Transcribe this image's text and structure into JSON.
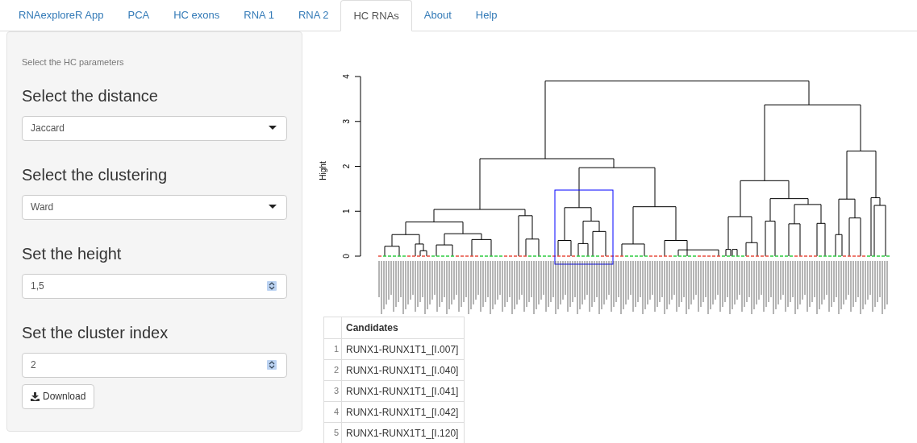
{
  "tabs": [
    {
      "label": "RNAexploreR App",
      "selected": false
    },
    {
      "label": "PCA",
      "selected": false
    },
    {
      "label": "HC exons",
      "selected": false
    },
    {
      "label": "RNA 1",
      "selected": false
    },
    {
      "label": "RNA 2",
      "selected": false
    },
    {
      "label": "HC RNAs",
      "selected": true
    },
    {
      "label": "About",
      "selected": false
    },
    {
      "label": "Help",
      "selected": false
    }
  ],
  "sidebar": {
    "caption": "Select the HC parameters",
    "inputs": [
      {
        "label": "Select the distance",
        "kind": "select",
        "value": "Jaccard"
      },
      {
        "label": "Select the clustering",
        "kind": "select",
        "value": "Ward"
      },
      {
        "label": "Set the height",
        "kind": "number",
        "value": "1,5"
      },
      {
        "label": "Set the cluster index",
        "kind": "number",
        "value": "2"
      }
    ],
    "download_button": "Download"
  },
  "plot": {
    "ylabel": "Hight",
    "yticks": [
      "0",
      "1",
      "2",
      "3",
      "4"
    ]
  },
  "table": {
    "column": "Candidates",
    "rows": [
      {
        "index": "1",
        "candidate": "RUNX1-RUNX1T1_[I.007]"
      },
      {
        "index": "2",
        "candidate": "RUNX1-RUNX1T1_[I.040]"
      },
      {
        "index": "3",
        "candidate": "RUNX1-RUNX1T1_[I.041]"
      },
      {
        "index": "4",
        "candidate": "RUNX1-RUNX1T1_[I.042]"
      },
      {
        "index": "5",
        "candidate": "RUNX1-RUNX1T1_[I.120]"
      }
    ]
  }
}
